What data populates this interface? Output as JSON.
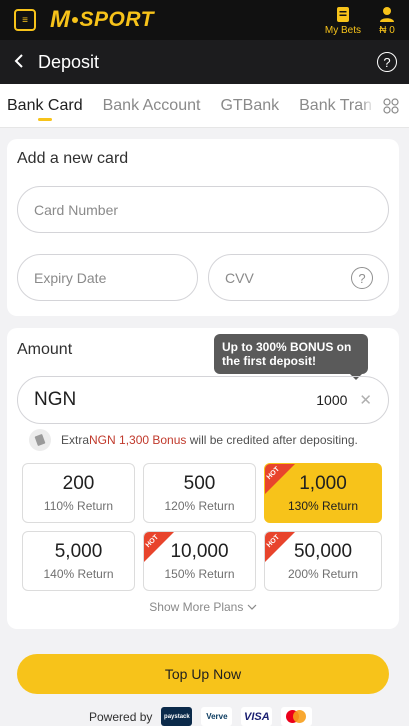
{
  "brand": {
    "name_initial": "M",
    "name_rest": "SPORT"
  },
  "top_actions": {
    "my_bets": "My Bets",
    "balance": "₦ 0"
  },
  "header": {
    "title": "Deposit"
  },
  "tabs": [
    {
      "label": "Bank Card",
      "active": true
    },
    {
      "label": "Bank Account",
      "active": false
    },
    {
      "label": "GTBank",
      "active": false
    },
    {
      "label": "Bank Tran",
      "active": false
    }
  ],
  "card_section": {
    "title": "Add a new card",
    "card_number_placeholder": "Card Number",
    "expiry_placeholder": "Expiry Date",
    "cvv_placeholder": "CVV"
  },
  "amount_section": {
    "title": "Amount",
    "tooltip": "Up to 300% BONUS on the first deposit!",
    "currency": "NGN",
    "value": "1000",
    "bonus_note": {
      "prefix": "Extra ",
      "highlight": "NGN 1,300 Bonus",
      "suffix": " will be credited after depositing."
    },
    "plans": [
      {
        "amount": "200",
        "return": "110% Return",
        "hot": false,
        "selected": false
      },
      {
        "amount": "500",
        "return": "120% Return",
        "hot": false,
        "selected": false
      },
      {
        "amount": "1,000",
        "return": "130% Return",
        "hot": true,
        "selected": true
      },
      {
        "amount": "5,000",
        "return": "140% Return",
        "hot": false,
        "selected": false
      },
      {
        "amount": "10,000",
        "return": "150% Return",
        "hot": true,
        "selected": false
      },
      {
        "amount": "50,000",
        "return": "200% Return",
        "hot": true,
        "selected": false
      }
    ],
    "hot_label": "HOT",
    "show_more": "Show More Plans"
  },
  "topup_button": "Top Up Now",
  "powered_by": {
    "label": "Powered by",
    "paystack": "paystack",
    "verve": "Verve",
    "visa": "VISA"
  },
  "colors": {
    "accent": "#f7c31a",
    "hot": "#e8442c",
    "bonus_text": "#c0392b",
    "header_bg": "#1c1c1e"
  }
}
